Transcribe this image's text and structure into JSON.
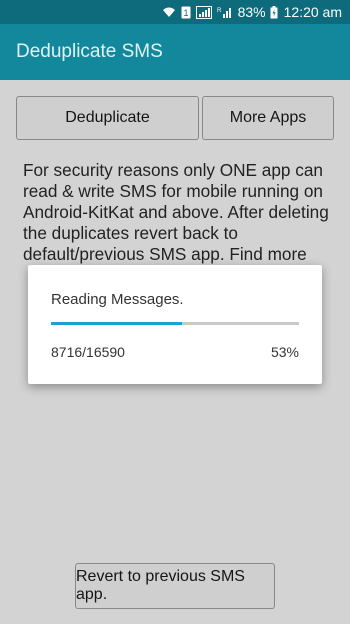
{
  "status_bar": {
    "battery": "83%",
    "time": "12:20 am",
    "icons": [
      "wifi-icon",
      "sim-icon",
      "signal-icon",
      "signal-r-icon",
      "battery-icon"
    ]
  },
  "app_bar": {
    "title": "Deduplicate SMS"
  },
  "buttons": {
    "deduplicate": "Deduplicate",
    "more_apps": "More Apps",
    "revert": "Revert to previous SMS app."
  },
  "info_text": "For security reasons only ONE app can read & write SMS for mobile running on Android-KitKat and above. After deleting the duplicates revert back to default/previous SMS app. Find more",
  "dialog": {
    "message": "Reading Messages.",
    "count": "8716/16590",
    "percent": "53%",
    "progress": 0.53
  },
  "colors": {
    "status_bar": "#0d6b7c",
    "app_bar": "#13889c",
    "progress": "#1e9fd8"
  }
}
